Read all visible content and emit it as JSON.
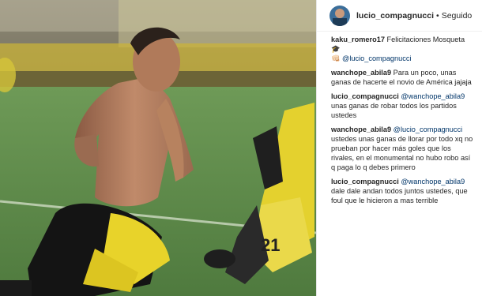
{
  "header": {
    "username": "lucio_compagnucci",
    "separator": "•",
    "follow_label": "Seguido"
  },
  "comments": [
    {
      "user": "kaku_romero17",
      "text": "Felicitaciones Mosqueta 🎓",
      "mention": "@lucio_compagnucci",
      "prefix": "👊🏻"
    },
    {
      "user": "wanchope_abila9",
      "text": "Para un poco, unas ganas de hacerte el novio de América jajaja"
    },
    {
      "user": "lucio_compagnucci",
      "mention": "@wanchope_abila9",
      "text": "unas ganas de robar todos los partidos ustedes"
    },
    {
      "user": "wanchope_abila9",
      "mention": "@lucio_compagnucci",
      "text": "ustedes unas ganas de llorar por todo xq no prueban por hacer más goles que los rivales, en el monumental no hubo robo así q paga lo q debes primero"
    },
    {
      "user": "lucio_compagnucci",
      "mention": "@wanchope_abila9",
      "text": "dale dale andan todos juntos ustedes, que foul que le hicieron a mas terrible"
    }
  ],
  "colors": {
    "kit_yellow": "#e8d32a",
    "pitch_green": "#5f8a4a",
    "mention_blue": "#003569"
  }
}
